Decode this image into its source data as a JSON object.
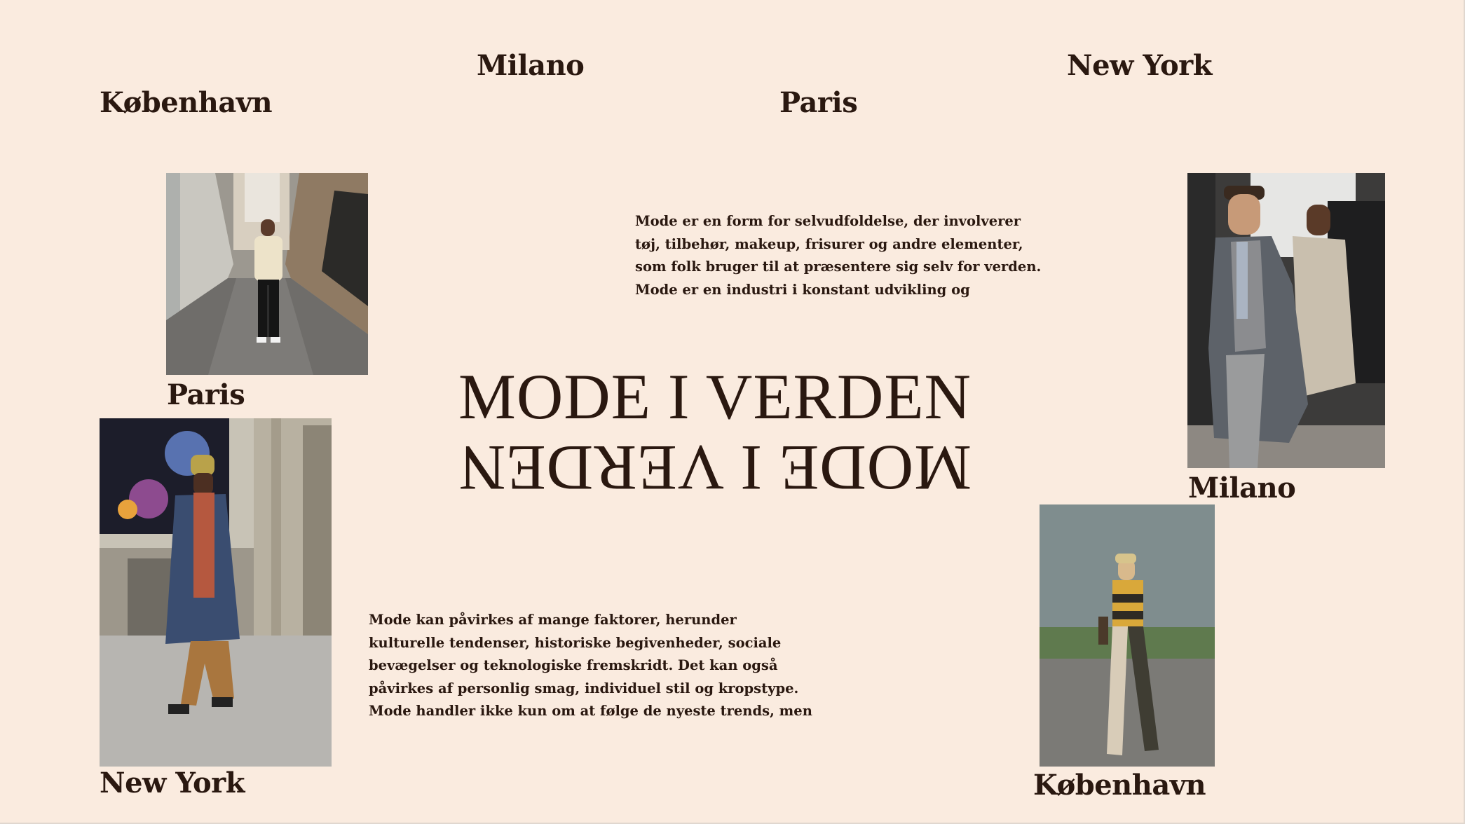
{
  "title": "MODE I VERDEN",
  "cities": {
    "top_milano": "Milano",
    "top_newyork": "New York",
    "top_kobenhavn": "København",
    "top_paris": "Paris",
    "caption_paris": "Paris",
    "caption_milano": "Milano",
    "caption_newyork": "New York",
    "caption_kobenhavn": "København"
  },
  "paragraphs": {
    "upper": [
      "Mode er en form for selvudfoldelse, der involverer",
      "tøj, tilbehør, makeup, frisurer og andre elementer,",
      "som folk bruger til at præsentere sig selv for verden.",
      "Mode er en industri i konstant udvikling og"
    ],
    "lower": [
      "Mode kan påvirkes af mange faktorer, herunder",
      "kulturelle tendenser, historiske begivenheder, sociale",
      "bevægelser og teknologiske fremskridt. Det kan også",
      "påvirkes af personlig smag, individuel stil og kropstype.",
      "Mode handler ikke kun om at følge de nyeste trends, men"
    ]
  },
  "photos": {
    "kobenhavn_man": "photo-street-man-cream-jacket",
    "poster_man": "photo-man-blue-coat-poster",
    "milano_man": "photo-man-grey-tweed-coat",
    "striped_man": "photo-man-striped-sweater"
  },
  "colors": {
    "background": "#faebdf",
    "text": "#2a1810"
  }
}
